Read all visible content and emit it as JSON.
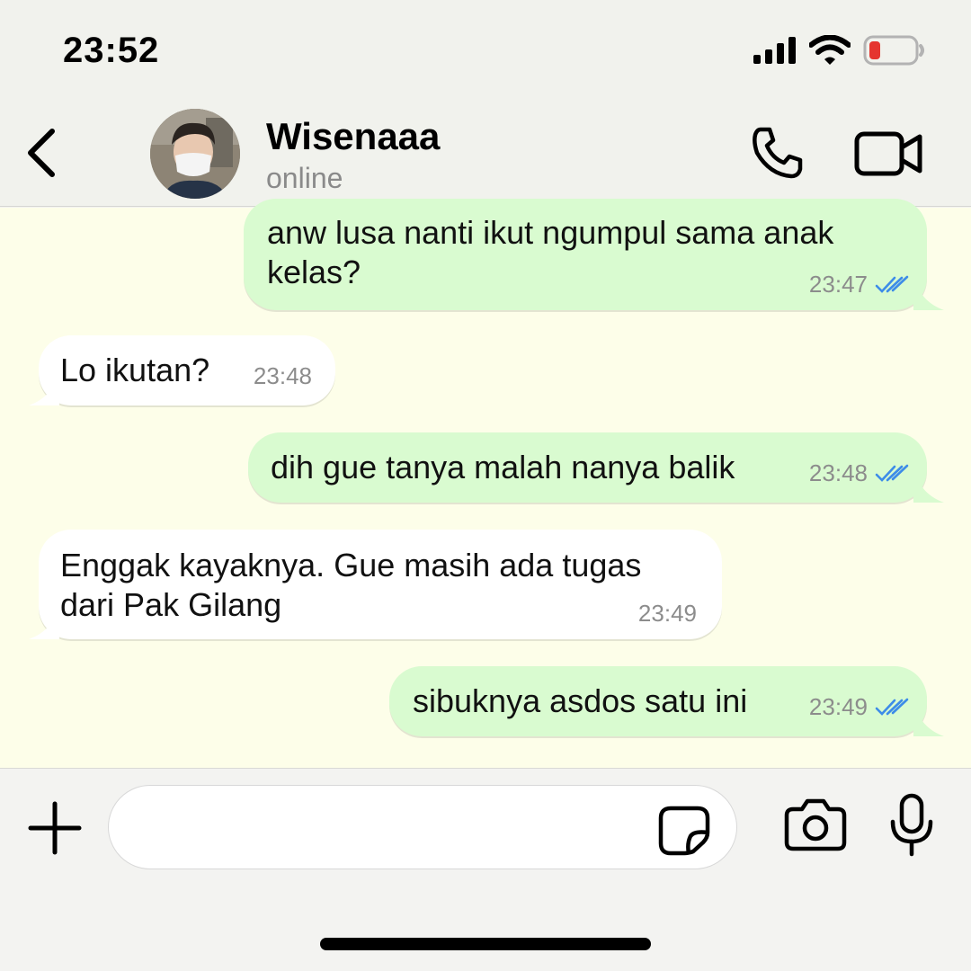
{
  "status_bar": {
    "time": "23:52",
    "icons": [
      "cellular-signal-icon",
      "wifi-icon",
      "battery-low-icon"
    ],
    "battery_color": "#e5352f"
  },
  "header": {
    "back_icon": "chevron-left-icon",
    "contact_name": "Wisenaaa",
    "contact_status": "online",
    "call_icon": "phone-icon",
    "video_icon": "video-camera-icon"
  },
  "messages": [
    {
      "direction": "out",
      "lines": [
        "anw lusa nanti ikut ngumpul sama anak",
        "kelas?"
      ],
      "time": "23:47",
      "read": true
    },
    {
      "direction": "in",
      "lines": [
        "Lo ikutan?"
      ],
      "time": "23:48"
    },
    {
      "direction": "out",
      "lines": [
        "dih gue tanya malah nanya balik"
      ],
      "time": "23:48",
      "read": true
    },
    {
      "direction": "in",
      "lines": [
        "Enggak kayaknya. Gue masih ada tugas",
        "dari Pak Gilang"
      ],
      "time": "23:49"
    },
    {
      "direction": "out",
      "lines": [
        "sibuknya asdos satu ini"
      ],
      "time": "23:49",
      "read": true
    }
  ],
  "input_bar": {
    "plus_icon": "plus-icon",
    "message_value": "",
    "sticker_icon": "sticker-icon",
    "camera_icon": "camera-icon",
    "mic_icon": "microphone-icon"
  },
  "colors": {
    "outgoing_bubble": "#d9fbd0",
    "incoming_bubble": "#ffffff",
    "chat_background": "#fdfee9",
    "read_ticks": "#3d8ce8"
  }
}
